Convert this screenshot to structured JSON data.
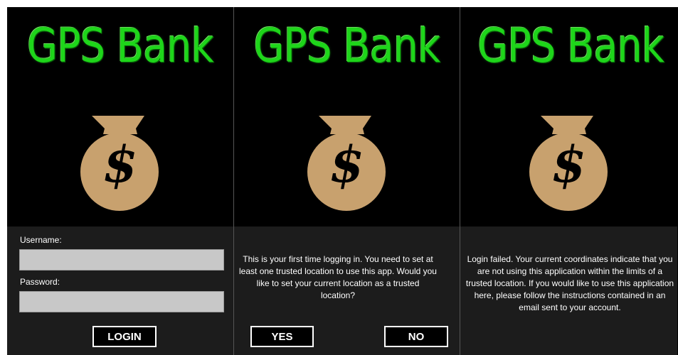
{
  "app": {
    "brand_name": "GPS Bank",
    "colors": {
      "brand_green": "#1ed61a",
      "bag_tan": "#c8a16e",
      "panel_bg": "#1c1c1c",
      "field_bg": "#c8c8c8"
    }
  },
  "screens": [
    {
      "name": "login",
      "logo_icon": "money-bag-icon",
      "dollar_symbol": "$",
      "username_label": "Username:",
      "username_value": "",
      "password_label": "Password:",
      "password_value": "",
      "login_button": "LOGIN"
    },
    {
      "name": "first-login",
      "logo_icon": "money-bag-icon",
      "dollar_symbol": "$",
      "message": "This is your first time logging in.  You need to set at least one trusted location to use this app.  Would you like to set your current location as a trusted location?",
      "yes_button": "YES",
      "no_button": "NO"
    },
    {
      "name": "login-failed",
      "logo_icon": "money-bag-icon",
      "dollar_symbol": "$",
      "message": "Login failed.  Your current coordinates indicate that you are not using this application within the limits of a trusted location.  If you would like to use this application here, please follow the instructions contained in an email sent to your account."
    }
  ]
}
